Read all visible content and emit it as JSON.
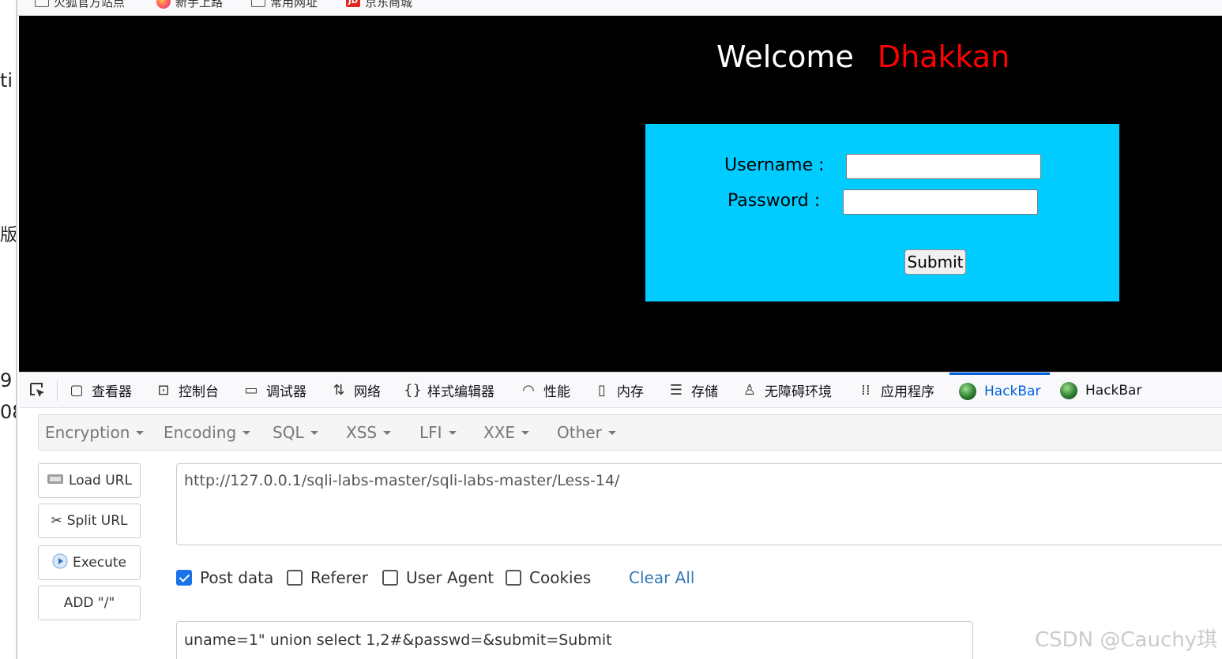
{
  "left_strip": {
    "fragments": [
      "ti",
      "版",
      "9",
      "08"
    ]
  },
  "bookmarks": [
    {
      "icon": "folder-icon",
      "label": "火狐官方站点"
    },
    {
      "icon": "firefox-icon",
      "label": "新手上路"
    },
    {
      "icon": "folder-icon",
      "label": "常用网址"
    },
    {
      "icon": "jd-icon",
      "label": "京东商城",
      "icon_text": "JD"
    }
  ],
  "page": {
    "welcome_text": "Welcome",
    "welcome_name": "Dhakkan",
    "username_label": "Username :",
    "password_label": "Password :",
    "username_value": "",
    "password_value": "",
    "submit_label": "Submit"
  },
  "devtools": {
    "tabs": [
      {
        "icon": "inspector-icon",
        "label": "查看器"
      },
      {
        "icon": "console-icon",
        "label": "控制台"
      },
      {
        "icon": "debugger-icon",
        "label": "调试器"
      },
      {
        "icon": "network-icon",
        "label": "网络"
      },
      {
        "icon": "style-editor-icon",
        "label": "样式编辑器"
      },
      {
        "icon": "performance-icon",
        "label": "性能"
      },
      {
        "icon": "memory-icon",
        "label": "内存"
      },
      {
        "icon": "storage-icon",
        "label": "存储"
      },
      {
        "icon": "accessibility-icon",
        "label": "无障碍环境"
      },
      {
        "icon": "application-icon",
        "label": "应用程序"
      },
      {
        "icon": "hackbar-icon",
        "label": "HackBar"
      },
      {
        "icon": "hackbar-icon",
        "label": "HackBar"
      }
    ],
    "active_tab": 10
  },
  "hackbar": {
    "menu": [
      "Encryption",
      "Encoding",
      "SQL",
      "XSS",
      "LFI",
      "XXE",
      "Other"
    ],
    "buttons": {
      "load_url": "Load URL",
      "split_url": "Split URL",
      "execute": "Execute",
      "add_slash": "ADD \"/\""
    },
    "url_value": "http://127.0.0.1/sqli-labs-master/sqli-labs-master/Less-14/",
    "options": [
      {
        "label": "Post data",
        "checked": true
      },
      {
        "label": "Referer",
        "checked": false
      },
      {
        "label": "User Agent",
        "checked": false
      },
      {
        "label": "Cookies",
        "checked": false
      }
    ],
    "clear_all": "Clear All",
    "post_value": "uname=1\" union select 1,2#&passwd=&submit=Submit"
  },
  "watermark": "CSDN @Cauchy琪",
  "colors": {
    "page_bg": "#000000",
    "welcome_name": "#ff0000",
    "login_box": "#00ccff",
    "devtools_active": "#0061e0",
    "checkbox_on": "#1a73e8",
    "clear_all": "#337ab7"
  }
}
